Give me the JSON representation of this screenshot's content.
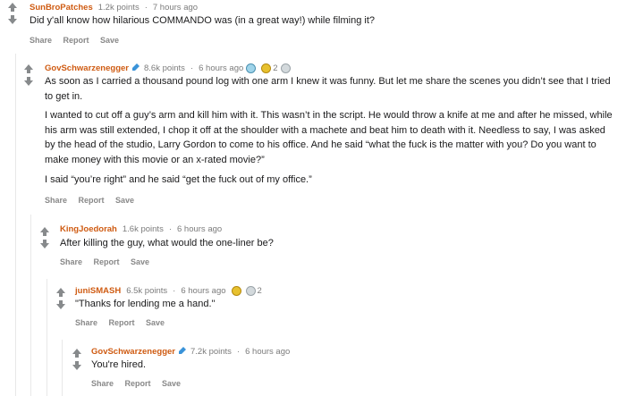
{
  "colors": {
    "author": "#cf5b12",
    "meta": "#7c7c7c",
    "actions": "#888888",
    "arrow": "#878a8c"
  },
  "comments": [
    {
      "author": "SunBroPatches",
      "points": "1.2k points",
      "time": "7 hours ago",
      "paragraphs": [
        "Did y'all know how hilarious COMMANDO was (in a great way!) while filming it?"
      ],
      "actions": [
        "Share",
        "Report",
        "Save"
      ]
    },
    {
      "author": "GovSchwarzenegger",
      "points": "8.6k points",
      "time": "6 hours ago",
      "award_count": "2",
      "paragraphs": [
        "As soon as I carried a thousand pound log with one arm I knew it was funny. But let me share the scenes you didn’t see that I tried to get in.",
        "I wanted to cut off a guy’s arm and kill him with it. This wasn’t in the script. He would throw a knife at me and after he missed, while his arm was still extended, I chop it off at the shoulder with a machete and beat him to death with it. Needless to say, I was asked by the head of the studio, Larry Gordon to come to his office. And he said “what the fuck is the matter with you? Do you want to make money with this movie or an x-rated movie?”",
        "I said “you’re right” and he said “get the fuck out of my office.”"
      ],
      "actions": [
        "Share",
        "Report",
        "Save"
      ]
    },
    {
      "author": "KingJoedorah",
      "points": "1.6k points",
      "time": "6 hours ago",
      "paragraphs": [
        "After killing the guy, what would the one-liner be?"
      ],
      "actions": [
        "Share",
        "Report",
        "Save"
      ]
    },
    {
      "author": "juniSMASH",
      "points": "6.5k points",
      "time": "6 hours ago",
      "award_count": "2",
      "paragraphs": [
        "\"Thanks for lending me a hand.\""
      ],
      "actions": [
        "Share",
        "Report",
        "Save"
      ]
    },
    {
      "author": "GovSchwarzenegger",
      "points": "7.2k points",
      "time": "6 hours ago",
      "paragraphs": [
        "You're hired."
      ],
      "actions": [
        "Share",
        "Report",
        "Save"
      ]
    }
  ]
}
